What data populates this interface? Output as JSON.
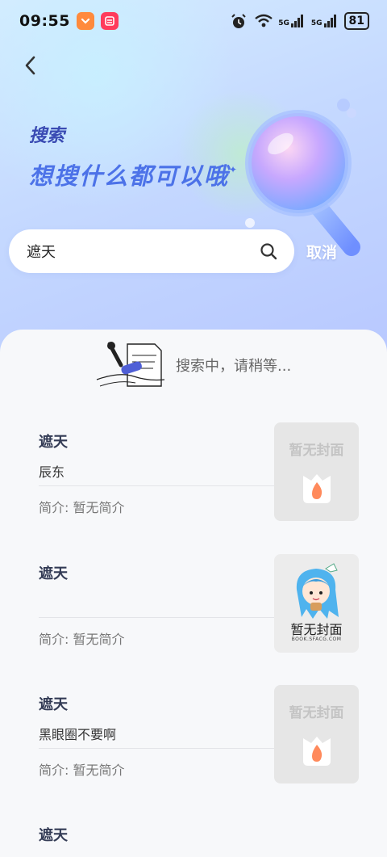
{
  "status_bar": {
    "time": "09:55",
    "network_1": "5G",
    "network_2": "5G",
    "battery": "81"
  },
  "header": {
    "title": "搜索",
    "subtitle": "想搜什么都可以哦",
    "sparkle": "✦"
  },
  "search": {
    "value": "遮天",
    "placeholder": "",
    "cancel_label": "取消"
  },
  "loading": {
    "text": "搜索中，请稍等..."
  },
  "results": [
    {
      "title": "遮天",
      "author": "辰东",
      "intro": "简介: 暂无简介",
      "cover": "暂无封面"
    },
    {
      "title": "遮天",
      "author": "",
      "intro": "简介: 暂无简介",
      "cover": "暂无封面",
      "cover_small": "BOOK.SFACG.COM"
    },
    {
      "title": "遮天",
      "author": "黑眼圈不要啊",
      "intro": "简介: 暂无简介",
      "cover": "暂无封面"
    },
    {
      "title": "遮天"
    }
  ],
  "colors": {
    "accent": "#4c72e8",
    "title_dark": "#3a4bb3",
    "logo_orange": "#ff8a5c"
  }
}
